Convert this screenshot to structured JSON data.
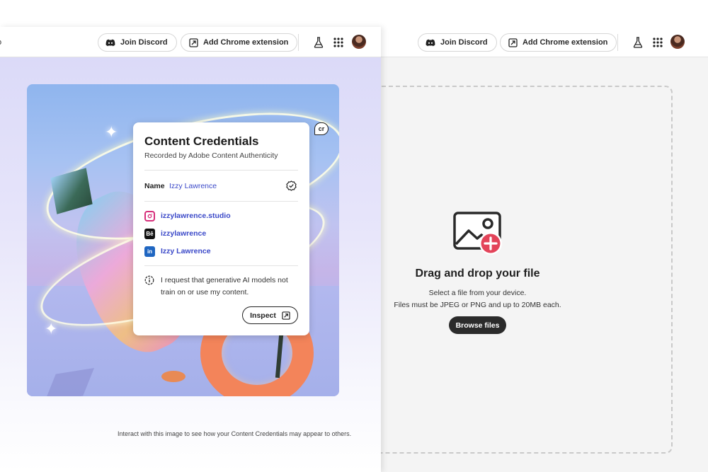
{
  "left_header": {
    "cut_text": "o",
    "discord_label": "Join Discord",
    "extension_label": "Add Chrome extension"
  },
  "right_header": {
    "discord_label": "Join Discord",
    "extension_label": "Add Chrome extension"
  },
  "credentials": {
    "badge": "cr",
    "title": "Content Credentials",
    "subtitle": "Recorded by Adobe Content Authenticity",
    "name_label": "Name",
    "name_value": "Izzy Lawrence",
    "socials": [
      {
        "icon": "instagram-icon",
        "label": "izzylawrence.studio"
      },
      {
        "icon": "behance-icon",
        "glyph": "Bē",
        "label": "izzylawrence"
      },
      {
        "icon": "linkedin-icon",
        "glyph": "in",
        "label": "Izzy Lawrence"
      }
    ],
    "ai_notice": "I request that generative AI models not train on or use my content.",
    "inspect_label": "Inspect"
  },
  "interact_note": "Interact with this image to see how your Content Credentials may appear to others.",
  "dropzone": {
    "title": "Drag and drop your file",
    "line1": "Select a file from your device.",
    "line2": "Files must be JPEG or PNG and up to 20MB each.",
    "browse_label": "Browse files"
  },
  "colors": {
    "link_blue": "#3a48c8",
    "dark_button": "#2b2b2b",
    "add_badge": "#e3445a"
  }
}
